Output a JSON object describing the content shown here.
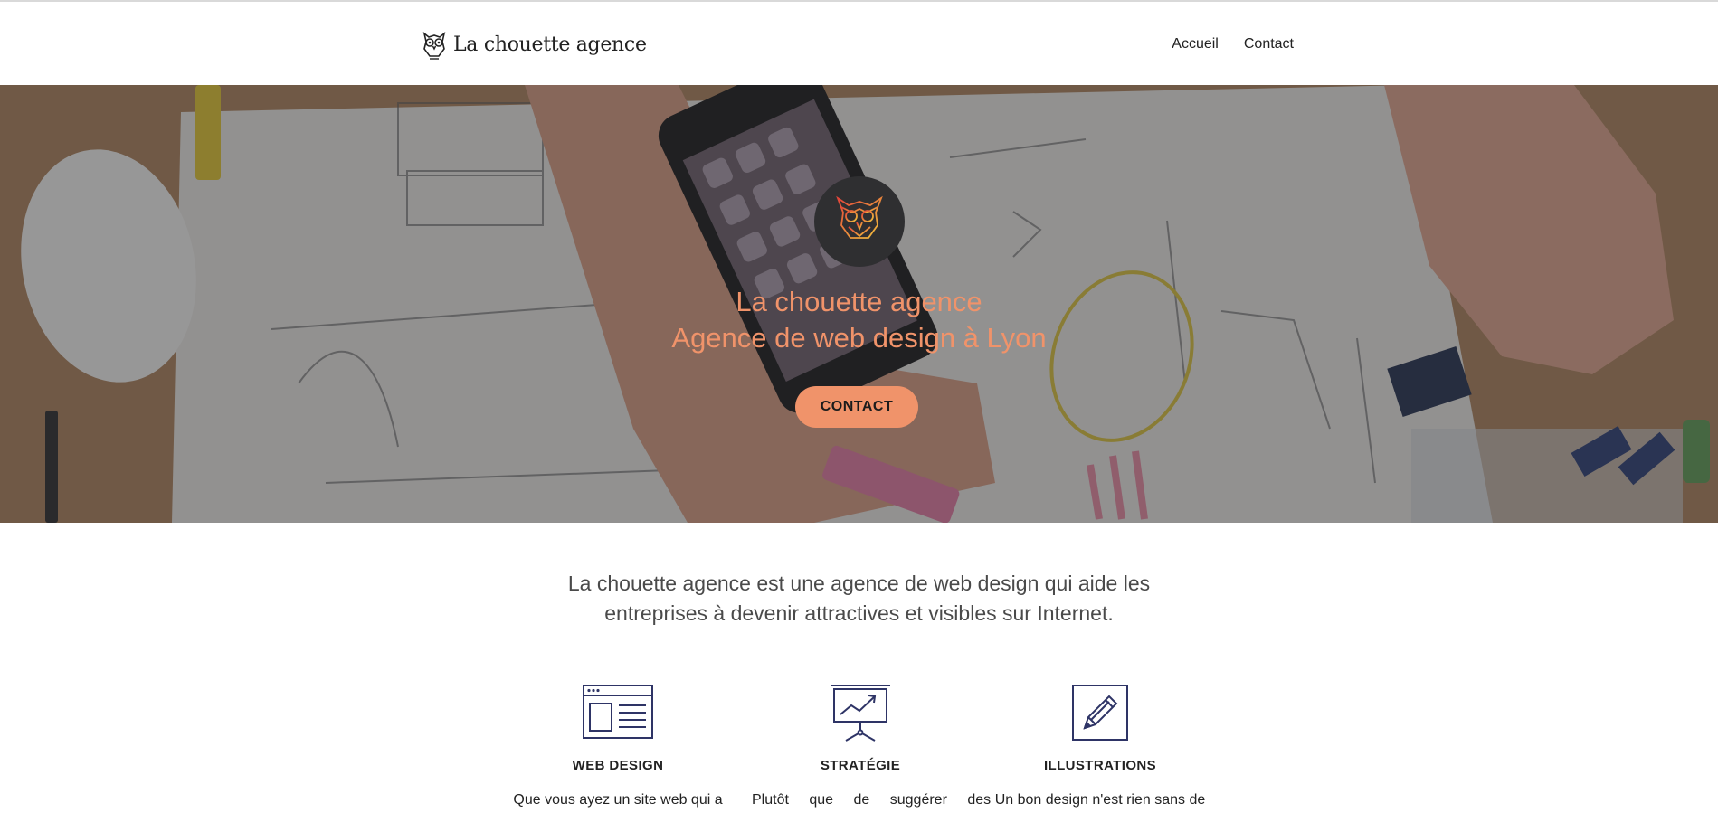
{
  "header": {
    "brand": "La chouette agence",
    "nav": [
      {
        "label": "Accueil"
      },
      {
        "label": "Contact"
      }
    ]
  },
  "hero": {
    "title_line1": "La chouette agence",
    "title_line2": "Agence de web design à Lyon",
    "cta_label": "CONTACT"
  },
  "intro": {
    "text": "La chouette agence est une agence de web design qui aide les entreprises à devenir attractives et visibles sur Internet."
  },
  "features": [
    {
      "icon": "browser-window-icon",
      "title": "WEB DESIGN",
      "text": "Que vous ayez un site web qui a"
    },
    {
      "icon": "presentation-chart-icon",
      "title": "STRATÉGIE",
      "text": "Plutôt que de suggérer des"
    },
    {
      "icon": "pencil-square-icon",
      "title": "ILLUSTRATIONS",
      "text": "Un bon design n'est rien sans de"
    }
  ],
  "colors": {
    "accent": "#f0936a",
    "icon_stroke": "#2e3466",
    "badge_bg": "#2f2f31"
  }
}
